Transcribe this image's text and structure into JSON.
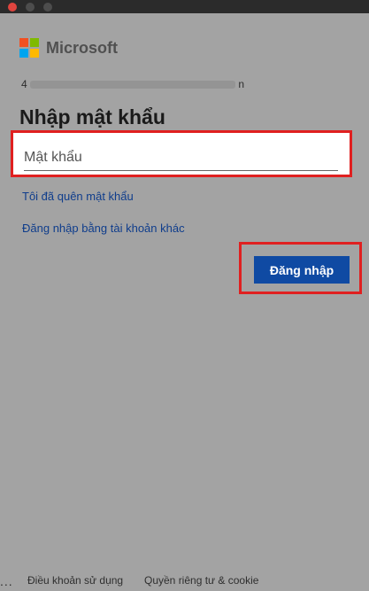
{
  "brand": {
    "name": "Microsoft"
  },
  "account": {
    "first_char": "4",
    "last_char": "n"
  },
  "heading": "Nhập mật khẩu",
  "password": {
    "placeholder": "Mật khẩu",
    "value": ""
  },
  "links": {
    "forgot": "Tôi đã quên mật khẩu",
    "other_account": "Đăng nhập bằng tài khoản khác"
  },
  "signin_button": "Đăng nhập",
  "footer": {
    "terms": "Điều khoản sử dụng",
    "privacy": "Quyền riêng tư & cookie",
    "more": "..."
  },
  "colors": {
    "highlight": "#e02020",
    "primary": "#0f4aa3",
    "link": "#0f3d8c"
  },
  "icons": [
    "window-close-icon",
    "window-minimize-icon",
    "window-maximize-icon",
    "microsoft-logo-icon",
    "more-options-icon"
  ]
}
